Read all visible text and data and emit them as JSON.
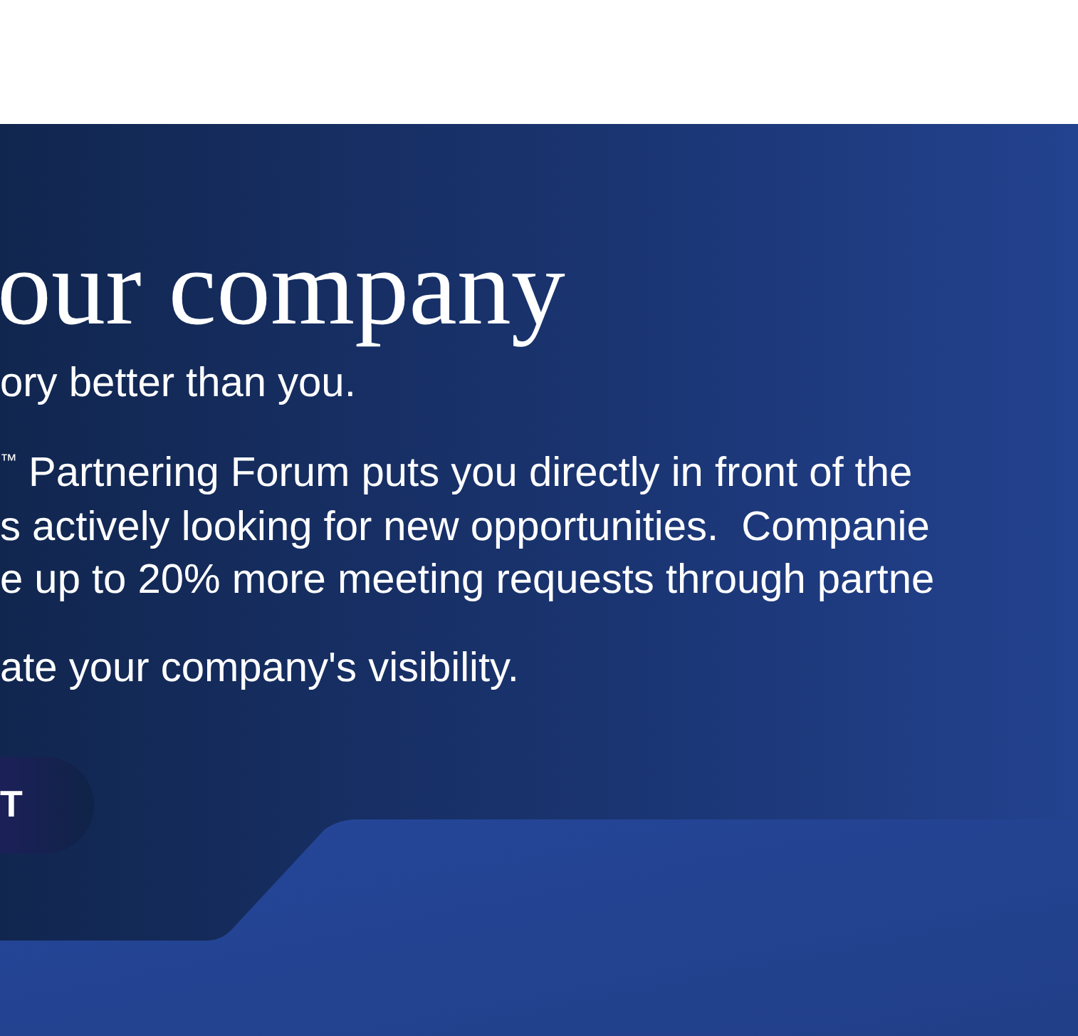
{
  "hero": {
    "heading": "our company",
    "tagline": "ory better than you.",
    "paragraph_lines": [
      "$^{™}$ Partnering Forum puts you directly in front of the",
      "s actively looking for new opportunities.  Companie",
      "e up to 20% more meeting requests through partne"
    ],
    "closing": "ate your company's visibility.",
    "button": "T"
  }
}
